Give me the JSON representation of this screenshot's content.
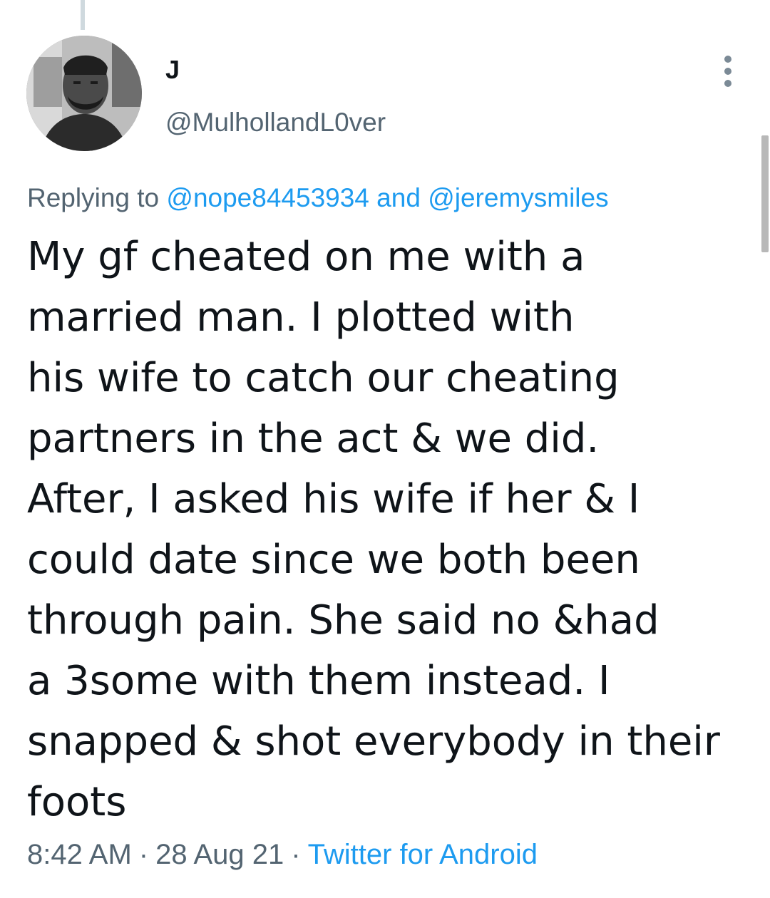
{
  "tweet": {
    "display_name": "J",
    "handle": "@MulhollandL0ver",
    "reply": {
      "prefix": "Replying to",
      "mention_1": "@nope84453934",
      "conjunction": "and",
      "mention_2": "@jeremysmiles"
    },
    "text_lines": [
      "My gf cheated on me with a",
      "married man. I plotted with",
      "his wife to catch our cheating",
      "partners in the act & we did.",
      "After, I asked his wife if her & I",
      "could date since we both been",
      "through pain. She said no &had",
      "a 3some with them instead. I",
      "snapped & shot everybody in their",
      "foots"
    ],
    "time": "8:42 AM",
    "separator": "·",
    "date": "28 Aug 21",
    "source": "Twitter for Android"
  },
  "icons": {
    "more": "more-vertical-icon",
    "avatar": "user-avatar"
  },
  "colors": {
    "link": "#1d9bf0",
    "secondary_text": "#536471",
    "primary_text": "#0f1419"
  }
}
